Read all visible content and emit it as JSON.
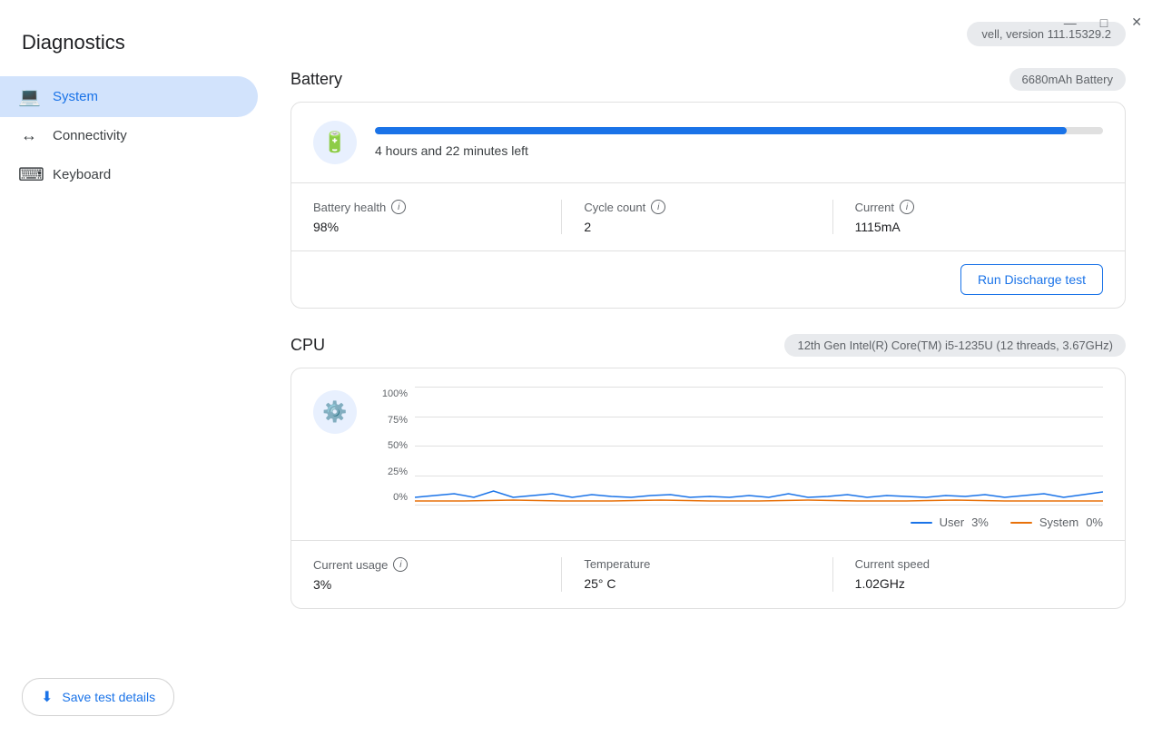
{
  "titlebar": {
    "minimize": "—",
    "maximize": "□",
    "close": "✕"
  },
  "app": {
    "title": "Diagnostics"
  },
  "sidebar": {
    "items": [
      {
        "id": "system",
        "label": "System",
        "icon": "💻",
        "active": true
      },
      {
        "id": "connectivity",
        "label": "Connectivity",
        "icon": "↔",
        "active": false
      },
      {
        "id": "keyboard",
        "label": "Keyboard",
        "icon": "⌨",
        "active": false
      }
    ],
    "save_button": "Save test details"
  },
  "system": {
    "version_badge": "vell, version 111.15329.2",
    "battery": {
      "section_title": "Battery",
      "capacity_badge": "6680mAh Battery",
      "progress_percent": 95,
      "time_remaining": "4 hours and 22 minutes left",
      "stats": [
        {
          "label": "Battery health",
          "has_info": true,
          "value": "98%"
        },
        {
          "label": "Cycle count",
          "has_info": true,
          "value": "2"
        },
        {
          "label": "Current",
          "has_info": true,
          "value": "1115mA"
        }
      ],
      "discharge_btn": "Run Discharge test"
    },
    "cpu": {
      "section_title": "CPU",
      "cpu_badge": "12th Gen Intel(R) Core(TM) i5-1235U (12 threads, 3.67GHz)",
      "chart": {
        "y_labels": [
          "100%",
          "75%",
          "50%",
          "25%",
          "0%"
        ],
        "legend": [
          {
            "label": "User",
            "value": "3%",
            "color": "#1a73e8"
          },
          {
            "label": "System",
            "value": "0%",
            "color": "#e8710a"
          }
        ]
      },
      "stats": [
        {
          "label": "Current usage",
          "has_info": true,
          "value": "3%"
        },
        {
          "label": "Temperature",
          "has_info": false,
          "value": "25° C"
        },
        {
          "label": "Current speed",
          "has_info": false,
          "value": "1.02GHz"
        }
      ]
    }
  }
}
